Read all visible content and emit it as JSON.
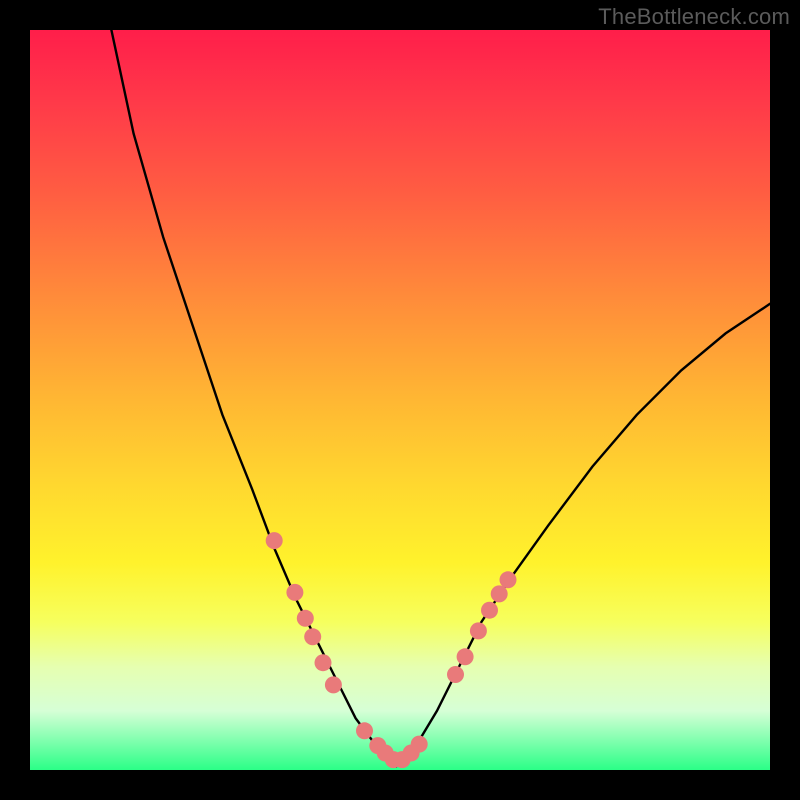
{
  "watermark": "TheBottleneck.com",
  "chart_data": {
    "type": "line",
    "title": "",
    "xlabel": "",
    "ylabel": "",
    "xlim": [
      0,
      100
    ],
    "ylim": [
      0,
      100
    ],
    "series": [
      {
        "name": "bottleneck-curve",
        "x": [
          11,
          14,
          18,
          22,
          26,
          30,
          33,
          36,
          39,
          42,
          44,
          47,
          49.5,
          52,
          55,
          58,
          61,
          65,
          70,
          76,
          82,
          88,
          94,
          100
        ],
        "y": [
          100,
          86,
          72,
          60,
          48,
          38,
          30,
          23,
          17,
          11,
          7,
          3,
          0.5,
          3,
          8,
          14,
          20,
          26,
          33,
          41,
          48,
          54,
          59,
          63
        ]
      }
    ],
    "markers": {
      "name": "highlight-points",
      "color": "#e97a7a",
      "points": [
        {
          "x": 33.0,
          "y": 31
        },
        {
          "x": 35.8,
          "y": 24
        },
        {
          "x": 37.2,
          "y": 20.5
        },
        {
          "x": 38.2,
          "y": 18
        },
        {
          "x": 39.6,
          "y": 14.5
        },
        {
          "x": 41.0,
          "y": 11.5
        },
        {
          "x": 45.2,
          "y": 5.3
        },
        {
          "x": 47.0,
          "y": 3.3
        },
        {
          "x": 48.0,
          "y": 2.3
        },
        {
          "x": 49.1,
          "y": 1.4
        },
        {
          "x": 50.3,
          "y": 1.4
        },
        {
          "x": 51.5,
          "y": 2.3
        },
        {
          "x": 52.6,
          "y": 3.5
        },
        {
          "x": 57.5,
          "y": 12.9
        },
        {
          "x": 58.8,
          "y": 15.3
        },
        {
          "x": 60.6,
          "y": 18.8
        },
        {
          "x": 62.1,
          "y": 21.6
        },
        {
          "x": 63.4,
          "y": 23.8
        },
        {
          "x": 64.6,
          "y": 25.7
        }
      ]
    }
  }
}
